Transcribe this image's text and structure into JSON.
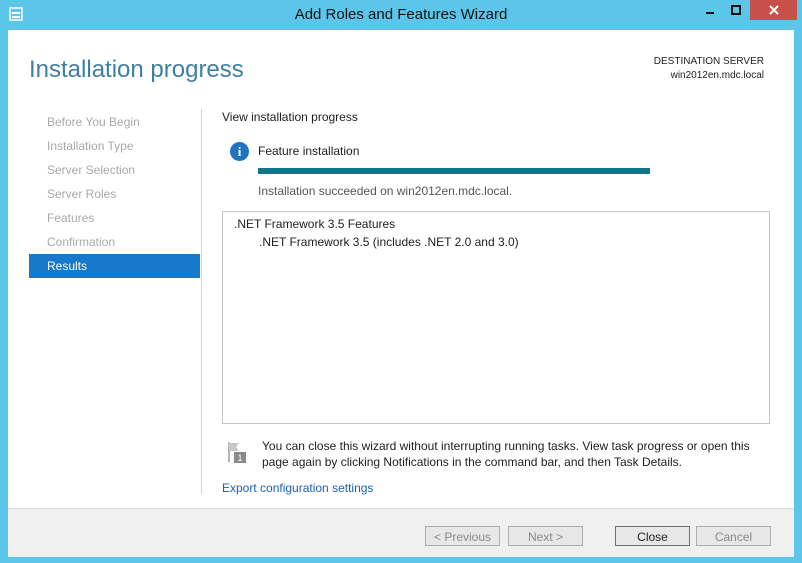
{
  "window": {
    "title": "Add Roles and Features Wizard"
  },
  "page": {
    "title": "Installation progress"
  },
  "destination": {
    "label": "DESTINATION SERVER",
    "server": "win2012en.mdc.local"
  },
  "nav": {
    "items": [
      {
        "label": "Before You Begin",
        "state": "disabled"
      },
      {
        "label": "Installation Type",
        "state": "disabled"
      },
      {
        "label": "Server Selection",
        "state": "disabled"
      },
      {
        "label": "Server Roles",
        "state": "disabled"
      },
      {
        "label": "Features",
        "state": "disabled"
      },
      {
        "label": "Confirmation",
        "state": "disabled"
      },
      {
        "label": "Results",
        "state": "active"
      }
    ]
  },
  "progress": {
    "heading": "View installation progress",
    "feature_label": "Feature installation",
    "percent": 100,
    "status": "Installation succeeded on win2012en.mdc.local."
  },
  "results": [
    ".NET Framework 3.5 Features",
    ".NET Framework 3.5 (includes .NET 2.0 and 3.0)"
  ],
  "notice": "You can close this wizard without interrupting running tasks. View task progress or open this page again by clicking Notifications in the command bar, and then Task Details.",
  "export_link": "Export configuration settings",
  "buttons": {
    "previous": "< Previous",
    "next": "Next >",
    "close": "Close",
    "cancel": "Cancel"
  },
  "colors": {
    "accent": "#1679c9",
    "frame": "#5bc5ea",
    "progress": "#117788",
    "close_button": "#c7504b"
  }
}
